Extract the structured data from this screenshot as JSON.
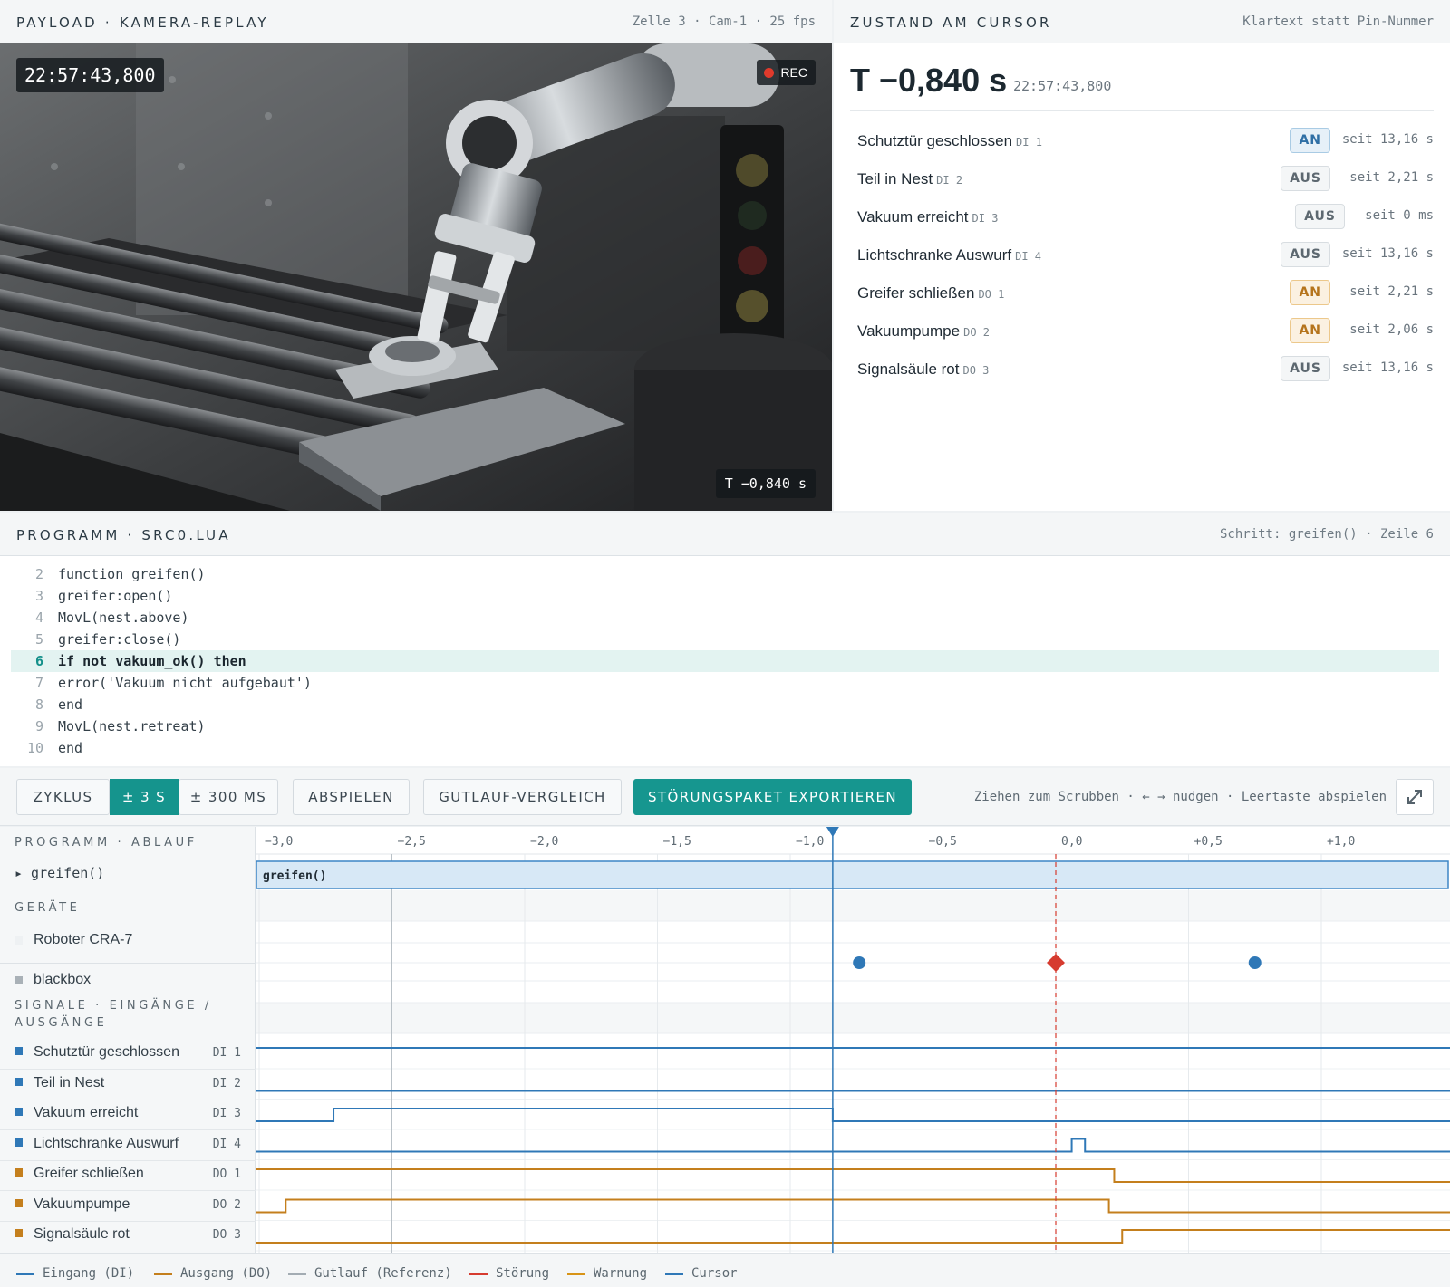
{
  "camera": {
    "title": "PAYLOAD · KAMERA-REPLAY",
    "meta": "Zelle 3 · Cam-1 · 25 fps",
    "timestamp": "22:57:43,800",
    "rec_label": "REC",
    "offset": "T −0,840 s"
  },
  "state": {
    "title": "ZUSTAND AM CURSOR",
    "meta": "Klartext statt Pin-Nummer",
    "t_big": "T −0,840 s",
    "timestamp": "22:57:43,800",
    "rows": [
      {
        "name": "Schutztür geschlossen",
        "code": "DI 1",
        "state": "AN",
        "since": "seit 13,16 s",
        "kind": "di"
      },
      {
        "name": "Teil in Nest",
        "code": "DI 2",
        "state": "AUS",
        "since": "seit 2,21 s",
        "kind": "aus"
      },
      {
        "name": "Vakuum erreicht",
        "code": "DI 3",
        "state": "AUS",
        "since": "seit 0 ms",
        "kind": "aus"
      },
      {
        "name": "Lichtschranke Auswurf",
        "code": "DI 4",
        "state": "AUS",
        "since": "seit 13,16 s",
        "kind": "aus"
      },
      {
        "name": "Greifer schließen",
        "code": "DO 1",
        "state": "AN",
        "since": "seit 2,21 s",
        "kind": "do"
      },
      {
        "name": "Vakuumpumpe",
        "code": "DO 2",
        "state": "AN",
        "since": "seit 2,06 s",
        "kind": "do"
      },
      {
        "name": "Signalsäule rot",
        "code": "DO 3",
        "state": "AUS",
        "since": "seit 13,16 s",
        "kind": "aus"
      }
    ]
  },
  "program": {
    "title": "PROGRAMM · SRC0.LUA",
    "meta": "Schritt: greifen() · Zeile 6",
    "highlight_line": 6,
    "lines": [
      {
        "n": "2",
        "text": "function greifen()"
      },
      {
        "n": "3",
        "text": "greifer:open()"
      },
      {
        "n": "4",
        "text": "MovL(nest.above)"
      },
      {
        "n": "5",
        "text": "greifer:close()"
      },
      {
        "n": "6",
        "text": "if not vakuum_ok() then"
      },
      {
        "n": "7",
        "text": "error('Vakuum nicht aufgebaut')"
      },
      {
        "n": "8",
        "text": "end"
      },
      {
        "n": "9",
        "text": "MovL(nest.retreat)"
      },
      {
        "n": "10",
        "text": "end"
      }
    ]
  },
  "toolbar": {
    "zyklus": "ZYKLUS",
    "pm3s": "± 3 S",
    "pm300": "± 300 MS",
    "abspielen": "ABSPIELEN",
    "gutlauf": "GUTLAUF-VERGLEICH",
    "export": "STÖRUNGSPAKET EXPORTIEREN",
    "hint": "Ziehen zum Scrubben · ← → nudgen · Leertaste abspielen",
    "active_zoom": "± 3 S"
  },
  "timeline": {
    "sec_program": "PROGRAMM · ABLAUF",
    "program_row": "▸ greifen()",
    "program_block": "greifen()",
    "sec_devices": "GERÄTE",
    "devices": [
      "Roboter CRA-7",
      "blackbox"
    ],
    "sec_signals_1": "SIGNALE · EINGÄNGE /",
    "sec_signals_2": "AUSGÄNGE",
    "signals": [
      {
        "name": "Schutztür geschlossen",
        "pin": "DI 1",
        "type": "DI"
      },
      {
        "name": "Teil in Nest",
        "pin": "DI 2",
        "type": "DI"
      },
      {
        "name": "Vakuum erreicht",
        "pin": "DI 3",
        "type": "DI"
      },
      {
        "name": "Lichtschranke Auswurf",
        "pin": "DI 4",
        "type": "DI"
      },
      {
        "name": "Greifer schließen",
        "pin": "DO 1",
        "type": "DO"
      },
      {
        "name": "Vakuumpumpe",
        "pin": "DO 2",
        "type": "DO"
      },
      {
        "name": "Signalsäule rot",
        "pin": "DO 3",
        "type": "DO"
      }
    ],
    "ticks": [
      "−3,0",
      "−2,5",
      "−2,0",
      "−1,5",
      "−1,0",
      "−0,5",
      "0,0",
      "+0,5",
      "+1,0"
    ],
    "tick_values": [
      -3.0,
      -2.5,
      -2.0,
      -1.5,
      -1.0,
      -0.5,
      0.0,
      0.5,
      1.0
    ],
    "x_range": [
      -3.0,
      1.5
    ],
    "cursor_t": -0.84,
    "fault_t": 0.0,
    "blackbox_events": [
      {
        "t": -0.74,
        "kind": "info"
      },
      {
        "t": 0.0,
        "kind": "fault"
      },
      {
        "t": 0.75,
        "kind": "info"
      }
    ],
    "traces": [
      {
        "pin": "DI 1",
        "initial": 1,
        "edges": []
      },
      {
        "pin": "DI 2",
        "initial": 0,
        "edges": []
      },
      {
        "pin": "DI 3",
        "initial": 0,
        "edges": [
          -2.72,
          -0.84
        ]
      },
      {
        "pin": "DI 4",
        "initial": 0,
        "edges": [
          0.06,
          0.11
        ]
      },
      {
        "pin": "DO 1",
        "initial": 1,
        "edges": [
          0.22
        ]
      },
      {
        "pin": "DO 2",
        "initial": 0,
        "edges": [
          -2.9,
          0.2
        ]
      },
      {
        "pin": "DO 3",
        "initial": 0,
        "edges": [
          0.25
        ]
      }
    ]
  },
  "legend": [
    {
      "label": "Eingang (DI)",
      "color": "#2f78b7"
    },
    {
      "label": "Ausgang (DO)",
      "color": "#c47f1d"
    },
    {
      "label": "Gutlauf (Referenz)",
      "color": "#a3acb3"
    },
    {
      "label": "Störung",
      "color": "#d63b2f"
    },
    {
      "label": "Warnung",
      "color": "#d89417"
    },
    {
      "label": "Cursor",
      "color": "#2f78b7"
    }
  ],
  "colors": {
    "accent": "#16968f",
    "di": "#2f78b7",
    "do": "#c47f1d",
    "fault": "#d63b2f"
  }
}
